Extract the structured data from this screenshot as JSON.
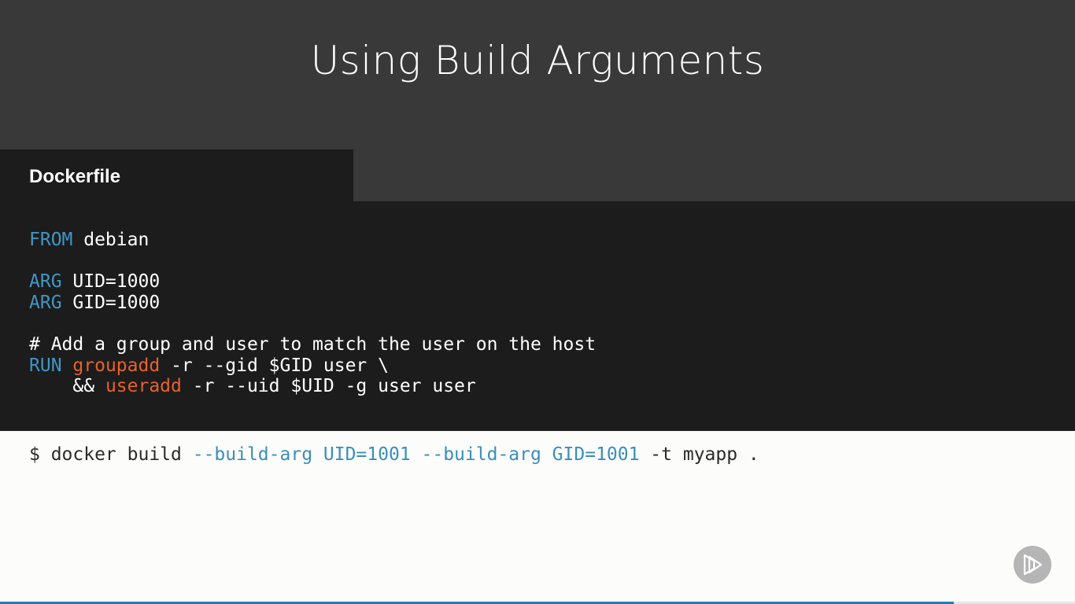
{
  "slide": {
    "title": "Using Build Arguments",
    "tab_label": "Dockerfile"
  },
  "dockerfile": {
    "line1": {
      "kw": "FROM",
      "rest": " debian"
    },
    "line2": {
      "kw": "ARG",
      "rest": " UID=1000"
    },
    "line3": {
      "kw": "ARG",
      "rest": " GID=1000"
    },
    "line4": {
      "comment": "# Add a group and user to match the user on the host"
    },
    "line5": {
      "kw": "RUN",
      "cmd": "groupadd",
      "rest": " -r --gid $GID user \\"
    },
    "line6": {
      "indent": "    && ",
      "cmd": "useradd",
      "rest": " -r --uid $UID -g user user"
    }
  },
  "terminal": {
    "prompt": "$ docker build ",
    "flags": "--build-arg UID=1001 --build-arg GID=1001",
    "rest": " -t myapp ."
  },
  "player": {
    "progress_fraction": 0.887,
    "icon": "play-icon"
  },
  "colors": {
    "header_bg": "#393939",
    "code_bg": "#1c1c1c",
    "keyword": "#3f97c4",
    "command": "#e8612c",
    "progress": "#1e7fb8"
  }
}
